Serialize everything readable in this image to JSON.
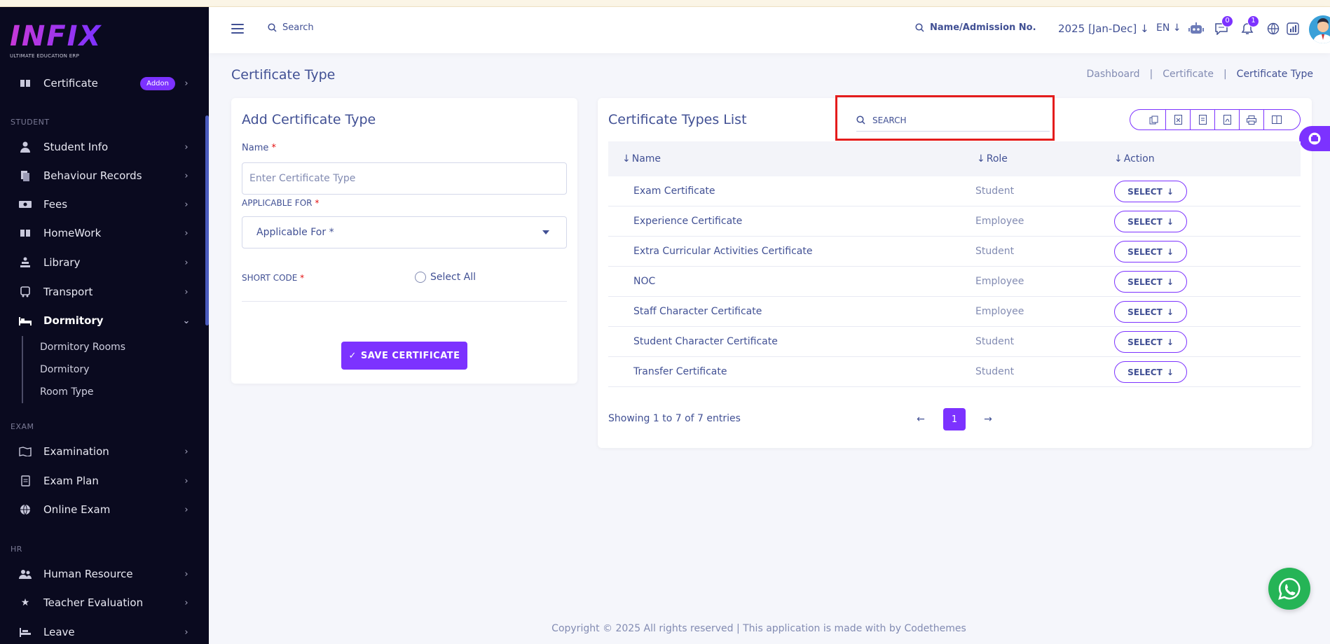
{
  "brand": {
    "logo_text": "INFIX",
    "tagline": "ULTIMATE EDUCATION ERP"
  },
  "sidebar": {
    "certificate": {
      "label": "Certificate",
      "badge": "Addon"
    },
    "sections": {
      "student": "STUDENT",
      "exam": "EXAM",
      "hr": "HR"
    },
    "items": [
      {
        "label": "Student Info"
      },
      {
        "label": "Behaviour Records"
      },
      {
        "label": "Fees"
      },
      {
        "label": "HomeWork"
      },
      {
        "label": "Library"
      },
      {
        "label": "Transport"
      },
      {
        "label": "Dormitory"
      },
      {
        "label": "Examination"
      },
      {
        "label": "Exam Plan"
      },
      {
        "label": "Online Exam"
      },
      {
        "label": "Human Resource"
      },
      {
        "label": "Teacher Evaluation"
      },
      {
        "label": "Leave"
      }
    ],
    "dormitory_sub": [
      "Dormitory Rooms",
      "Dormitory",
      "Room Type"
    ]
  },
  "header": {
    "search_label": "Search",
    "student_search_label": "Name/Admission No.",
    "session": "2025 [Jan-Dec]",
    "language": "EN",
    "message_badge": "0",
    "notification_badge": "1"
  },
  "page": {
    "title": "Certificate Type",
    "breadcrumb": [
      "Dashboard",
      "Certificate",
      "Certificate Type"
    ]
  },
  "form": {
    "title": "Add Certificate Type",
    "name_label": "Name",
    "name_placeholder": "Enter Certificate Type",
    "applicable_label": "APPLICABLE FOR",
    "applicable_value": "Applicable For *",
    "short_code_label": "SHORT CODE",
    "select_all_label": "Select All",
    "required_mark": "*",
    "save_label": "SAVE CERTIFICATE"
  },
  "list": {
    "title": "Certificate Types List",
    "search_placeholder": "SEARCH",
    "columns": [
      "Name",
      "Role",
      "Action"
    ],
    "select_label": "SELECT",
    "rows": [
      {
        "name": "Exam Certificate",
        "role": "Student"
      },
      {
        "name": "Experience Certificate",
        "role": "Employee"
      },
      {
        "name": "Extra Curricular Activities Certificate",
        "role": "Student"
      },
      {
        "name": "NOC",
        "role": "Employee"
      },
      {
        "name": "Staff Character Certificate",
        "role": "Employee"
      },
      {
        "name": "Student Character Certificate",
        "role": "Student"
      },
      {
        "name": "Transfer Certificate",
        "role": "Student"
      }
    ],
    "showing": "Showing 1 to 7 of 7 entries",
    "current_page": "1"
  },
  "footer": {
    "text": "Copyright © 2025 All rights reserved | This application is made with by Codethemes"
  },
  "colors": {
    "accent": "#7c32ff",
    "text": "#415094",
    "sidebar_bg": "#0a0a1f",
    "highlight": "#e41c1c",
    "whatsapp": "#25b456"
  }
}
